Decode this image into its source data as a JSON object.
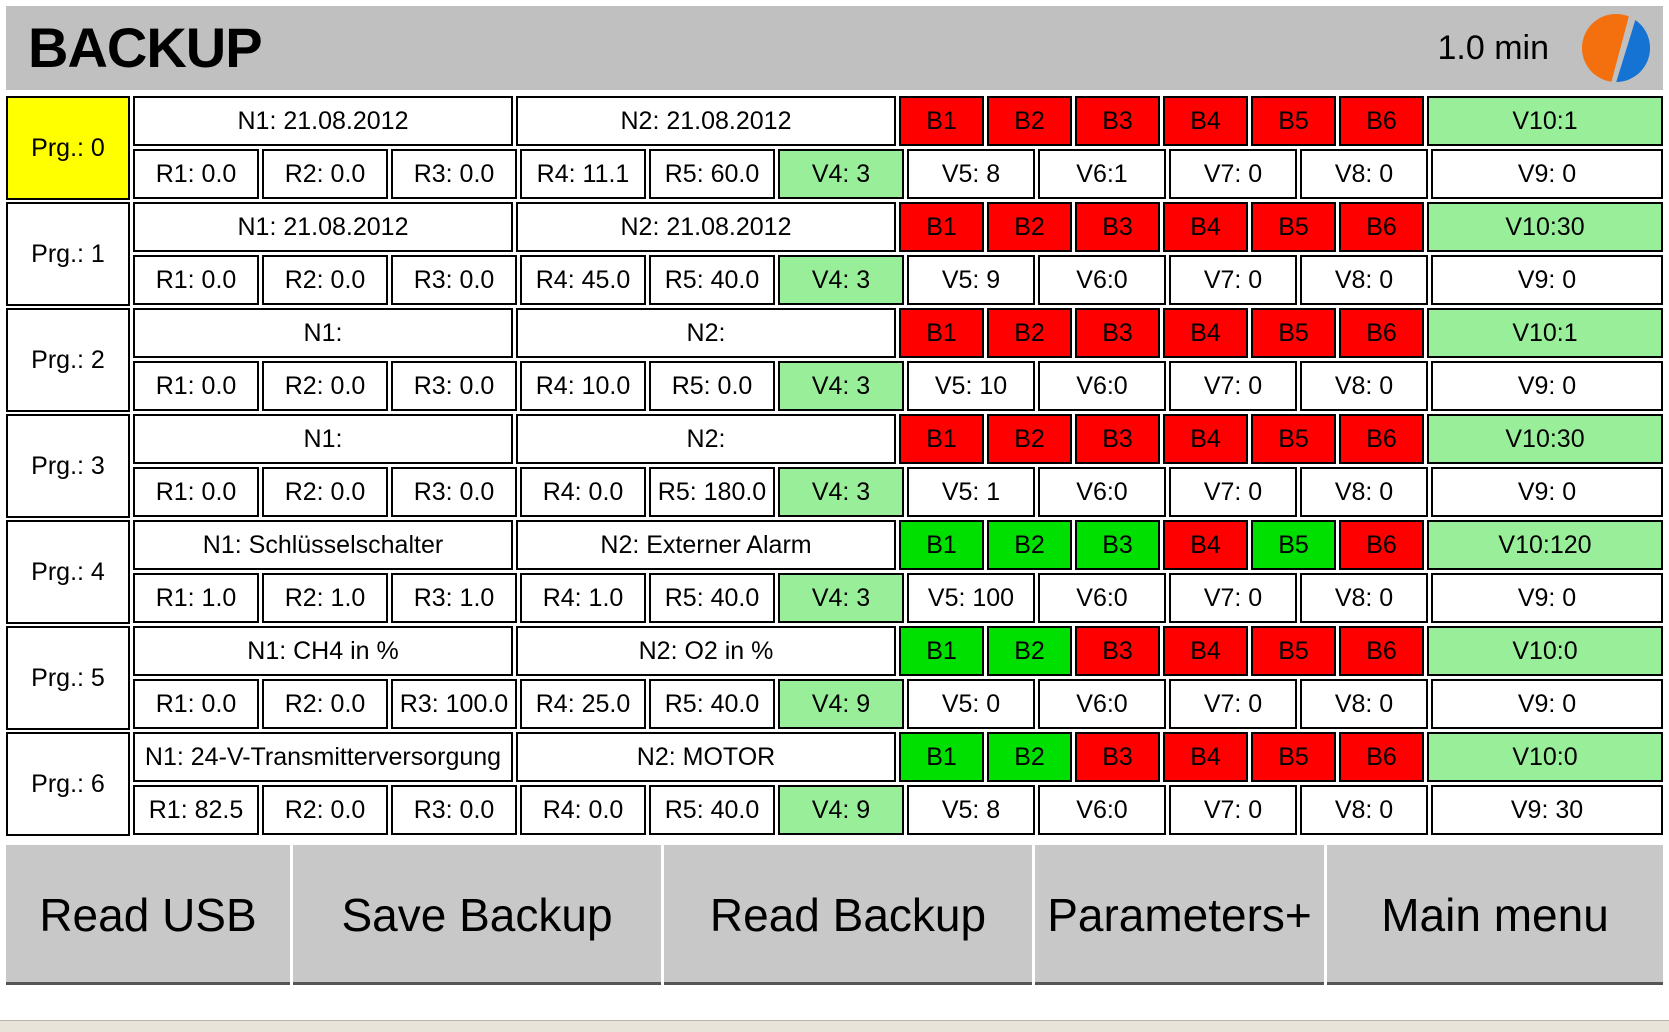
{
  "header": {
    "title": "BACKUP",
    "time": "1.0 min",
    "logo_name": "company-logo",
    "logo_colors": {
      "left": "#f4700f",
      "right": "#1473d3"
    },
    "background": "#c0c0c0"
  },
  "colors": {
    "active_program": "#ffff00",
    "state_off": "#ff0000",
    "state_on": "#00e000",
    "value_highlight": "#99ee99",
    "button_face": "#c8c8c8"
  },
  "rows": [
    {
      "prg": "Prg.: 0",
      "active": true,
      "n1": "N1: 21.08.2012",
      "n2": "N2: 21.08.2012",
      "b": [
        {
          "label": "B1",
          "state": "off"
        },
        {
          "label": "B2",
          "state": "off"
        },
        {
          "label": "B3",
          "state": "off"
        },
        {
          "label": "B4",
          "state": "off"
        },
        {
          "label": "B5",
          "state": "off"
        },
        {
          "label": "B6",
          "state": "off"
        }
      ],
      "v10": "V10:1",
      "r1": "R1: 0.0",
      "r2": "R2: 0.0",
      "r3": "R3: 0.0",
      "r4": "R4: 11.1",
      "r5": "R5: 60.0",
      "v4": "V4: 3",
      "v5": "V5: 8",
      "v6": "V6:1",
      "v7": "V7: 0",
      "v8": "V8: 0",
      "v9": "V9: 0"
    },
    {
      "prg": "Prg.: 1",
      "active": false,
      "n1": "N1: 21.08.2012",
      "n2": "N2: 21.08.2012",
      "b": [
        {
          "label": "B1",
          "state": "off"
        },
        {
          "label": "B2",
          "state": "off"
        },
        {
          "label": "B3",
          "state": "off"
        },
        {
          "label": "B4",
          "state": "off"
        },
        {
          "label": "B5",
          "state": "off"
        },
        {
          "label": "B6",
          "state": "off"
        }
      ],
      "v10": "V10:30",
      "r1": "R1: 0.0",
      "r2": "R2: 0.0",
      "r3": "R3: 0.0",
      "r4": "R4: 45.0",
      "r5": "R5: 40.0",
      "v4": "V4: 3",
      "v5": "V5: 9",
      "v6": "V6:0",
      "v7": "V7: 0",
      "v8": "V8: 0",
      "v9": "V9: 0"
    },
    {
      "prg": "Prg.: 2",
      "active": false,
      "n1": "N1:",
      "n2": "N2:",
      "b": [
        {
          "label": "B1",
          "state": "off"
        },
        {
          "label": "B2",
          "state": "off"
        },
        {
          "label": "B3",
          "state": "off"
        },
        {
          "label": "B4",
          "state": "off"
        },
        {
          "label": "B5",
          "state": "off"
        },
        {
          "label": "B6",
          "state": "off"
        }
      ],
      "v10": "V10:1",
      "r1": "R1: 0.0",
      "r2": "R2: 0.0",
      "r3": "R3: 0.0",
      "r4": "R4: 10.0",
      "r5": "R5: 0.0",
      "v4": "V4: 3",
      "v5": "V5: 10",
      "v6": "V6:0",
      "v7": "V7: 0",
      "v8": "V8: 0",
      "v9": "V9: 0"
    },
    {
      "prg": "Prg.: 3",
      "active": false,
      "n1": "N1:",
      "n2": "N2:",
      "b": [
        {
          "label": "B1",
          "state": "off"
        },
        {
          "label": "B2",
          "state": "off"
        },
        {
          "label": "B3",
          "state": "off"
        },
        {
          "label": "B4",
          "state": "off"
        },
        {
          "label": "B5",
          "state": "off"
        },
        {
          "label": "B6",
          "state": "off"
        }
      ],
      "v10": "V10:30",
      "r1": "R1: 0.0",
      "r2": "R2: 0.0",
      "r3": "R3: 0.0",
      "r4": "R4: 0.0",
      "r5": "R5: 180.0",
      "v4": "V4: 3",
      "v5": "V5: 1",
      "v6": "V6:0",
      "v7": "V7: 0",
      "v8": "V8: 0",
      "v9": "V9: 0"
    },
    {
      "prg": "Prg.: 4",
      "active": false,
      "n1": "N1: Schlüsselschalter",
      "n2": "N2: Externer Alarm",
      "b": [
        {
          "label": "B1",
          "state": "on"
        },
        {
          "label": "B2",
          "state": "on"
        },
        {
          "label": "B3",
          "state": "on"
        },
        {
          "label": "B4",
          "state": "off"
        },
        {
          "label": "B5",
          "state": "on"
        },
        {
          "label": "B6",
          "state": "off"
        }
      ],
      "v10": "V10:120",
      "r1": "R1: 1.0",
      "r2": "R2: 1.0",
      "r3": "R3: 1.0",
      "r4": "R4: 1.0",
      "r5": "R5: 40.0",
      "v4": "V4: 3",
      "v5": "V5: 100",
      "v6": "V6:0",
      "v7": "V7: 0",
      "v8": "V8: 0",
      "v9": "V9: 0"
    },
    {
      "prg": "Prg.: 5",
      "active": false,
      "n1": "N1: CH4  in  %",
      "n2": "N2: O2  in  %",
      "b": [
        {
          "label": "B1",
          "state": "on"
        },
        {
          "label": "B2",
          "state": "on"
        },
        {
          "label": "B3",
          "state": "off"
        },
        {
          "label": "B4",
          "state": "off"
        },
        {
          "label": "B5",
          "state": "off"
        },
        {
          "label": "B6",
          "state": "off"
        }
      ],
      "v10": "V10:0",
      "r1": "R1: 0.0",
      "r2": "R2: 0.0",
      "r3": "R3: 100.0",
      "r4": "R4: 25.0",
      "r5": "R5: 40.0",
      "v4": "V4: 9",
      "v5": "V5: 0",
      "v6": "V6:0",
      "v7": "V7: 0",
      "v8": "V8: 0",
      "v9": "V9: 0"
    },
    {
      "prg": "Prg.: 6",
      "active": false,
      "n1": "N1: 24-V-Transmitterversorgung",
      "n2": "N2: MOTOR",
      "b": [
        {
          "label": "B1",
          "state": "on"
        },
        {
          "label": "B2",
          "state": "on"
        },
        {
          "label": "B3",
          "state": "off"
        },
        {
          "label": "B4",
          "state": "off"
        },
        {
          "label": "B5",
          "state": "off"
        },
        {
          "label": "B6",
          "state": "off"
        }
      ],
      "v10": "V10:0",
      "r1": "R1: 82.5",
      "r2": "R2: 0.0",
      "r3": "R3: 0.0",
      "r4": "R4: 0.0",
      "r5": "R5: 40.0",
      "v4": "V4: 9",
      "v5": "V5: 8",
      "v6": "V6:0",
      "v7": "V7: 0",
      "v8": "V8: 0",
      "v9": "V9: 30"
    }
  ],
  "buttons": [
    {
      "label": "Read USB"
    },
    {
      "label": "Save Backup"
    },
    {
      "label": "Read Backup"
    },
    {
      "label": "Parameters+"
    },
    {
      "label": "Main menu"
    }
  ]
}
